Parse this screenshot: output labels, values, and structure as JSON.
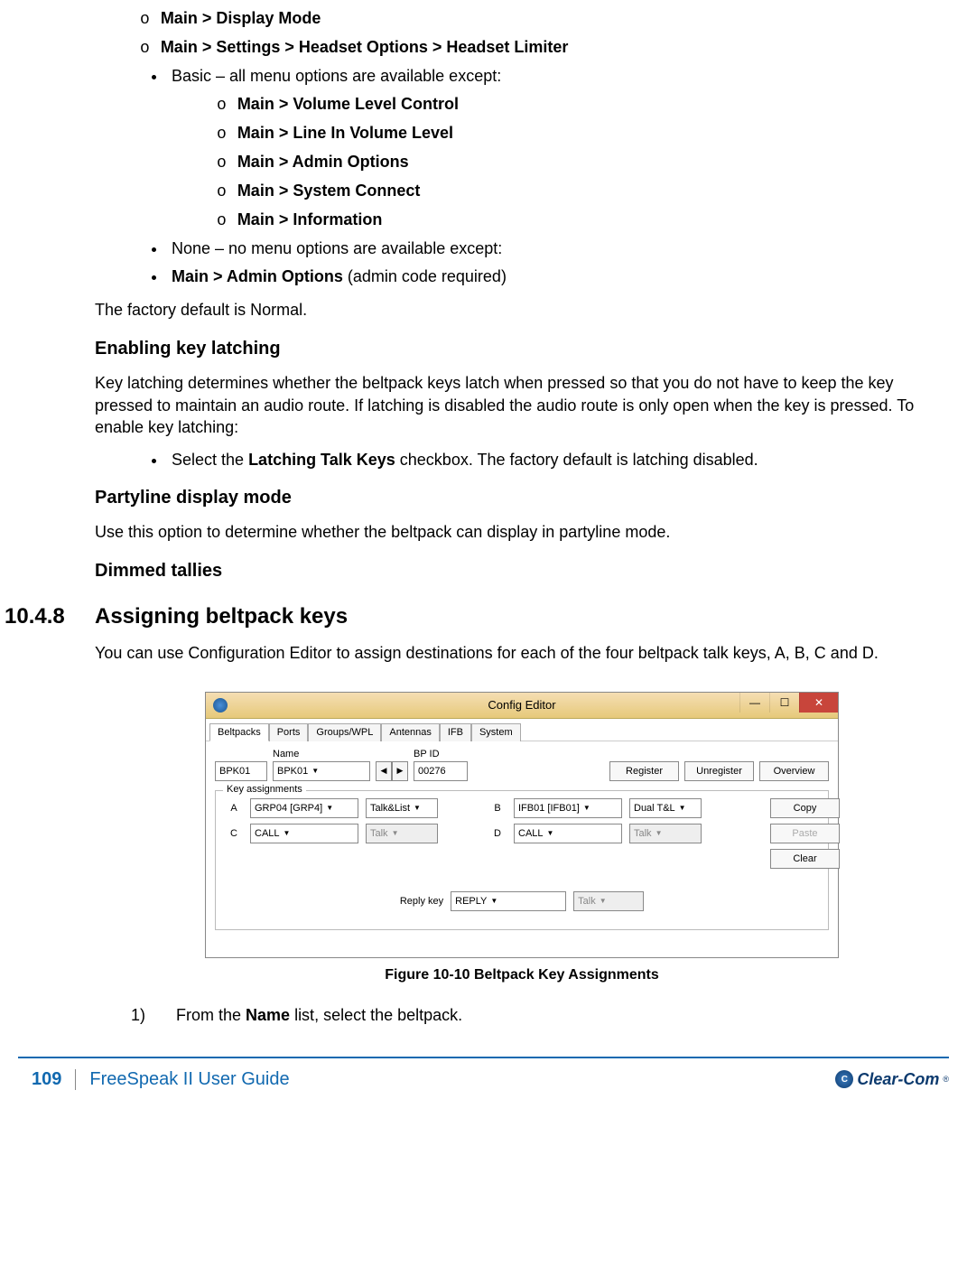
{
  "bullets_top_circle": [
    "Main > Display Mode",
    "Main > Settings > Headset Options > Headset Limiter"
  ],
  "basic_line": "Basic – all menu options are available except:",
  "basic_items": [
    "Main > Volume Level Control",
    "Main > Line In Volume Level",
    "Main > Admin Options",
    "Main > System Connect",
    "Main > Information"
  ],
  "none_line": "None – no menu options are available except:",
  "admin_bold": "Main > Admin Options",
  "admin_tail": " (admin code required)",
  "factory_default": "The factory default is Normal.",
  "h_latching": "Enabling key latching",
  "p_latching": "Key latching determines whether the beltpack keys latch when pressed so that you do not have to keep the key pressed to maintain an audio route. If latching is disabled the audio route is only open when the key is pressed. To enable key latching:",
  "latching_bullet_pre": "Select the ",
  "latching_bullet_bold": "Latching Talk Keys",
  "latching_bullet_post": " checkbox. The factory default is latching disabled.",
  "h_partyline": "Partyline display mode",
  "p_partyline": "Use this option to determine whether the beltpack can display in partyline mode.",
  "h_dimmed": "Dimmed tallies",
  "section_num": "10.4.8",
  "section_title": "Assigning beltpack keys",
  "p_assigning": "You can use Configuration Editor to assign destinations for each of the four beltpack talk keys, A, B, C and D.",
  "config": {
    "title": "Config Editor",
    "tabs": [
      "Beltpacks",
      "Ports",
      "Groups/WPL",
      "Antennas",
      "IFB",
      "System"
    ],
    "name_label": "Name",
    "bpid_label": "BP ID",
    "id_left": "BPK01",
    "name_value": "BPK01",
    "bpid_value": "00276",
    "btn_register": "Register",
    "btn_unregister": "Unregister",
    "btn_overview": "Overview",
    "legend": "Key assignments",
    "keys": {
      "A": {
        "assign": "GRP04 [GRP4]",
        "mode": "Talk&List"
      },
      "B": {
        "assign": "IFB01  [IFB01]",
        "mode": "Dual T&L"
      },
      "C": {
        "assign": "CALL",
        "mode": "Talk"
      },
      "D": {
        "assign": "CALL",
        "mode": "Talk"
      }
    },
    "btn_copy": "Copy",
    "btn_paste": "Paste",
    "btn_clear": "Clear",
    "reply_label": "Reply key",
    "reply_value": "REPLY",
    "reply_mode": "Talk"
  },
  "figure_caption": "Figure 10-10 Beltpack Key Assignments",
  "step1_num": "1)",
  "step1_pre": "From the ",
  "step1_bold": "Name",
  "step1_post": " list, select the beltpack.",
  "footer": {
    "page": "109",
    "title": "FreeSpeak II User Guide",
    "brand": "Clear-Com"
  }
}
